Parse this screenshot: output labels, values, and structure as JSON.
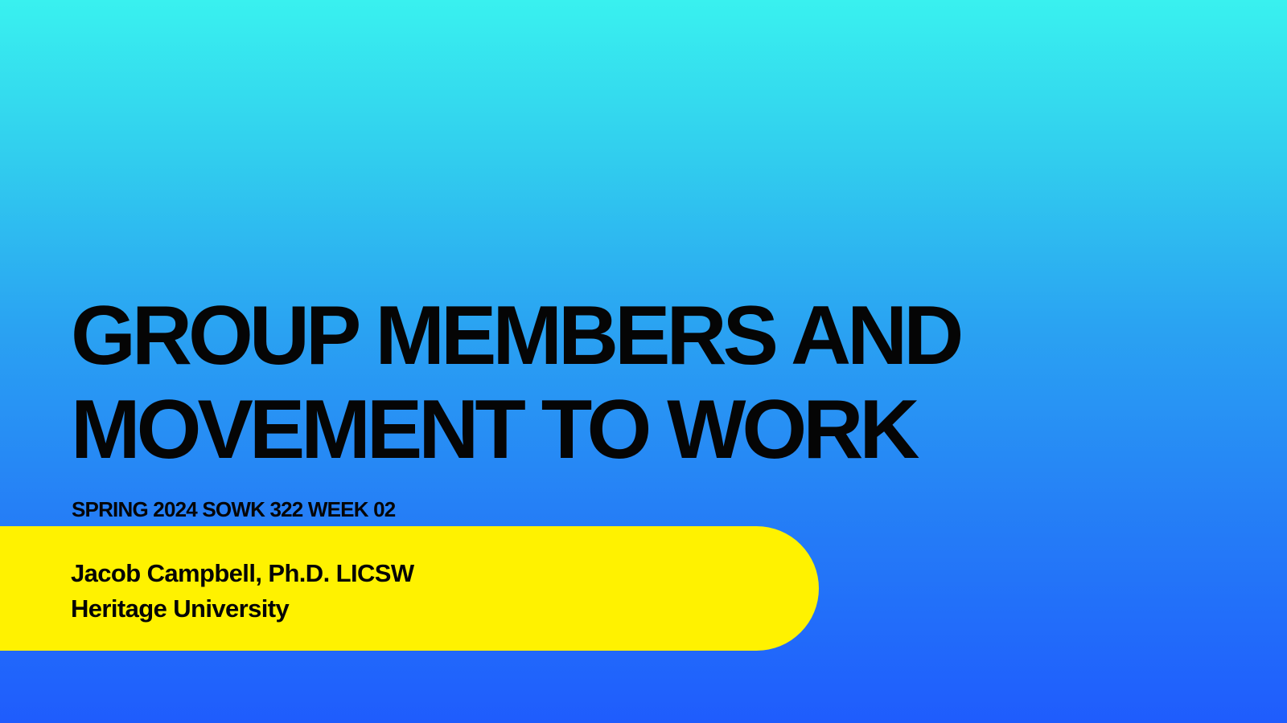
{
  "slide": {
    "title": "GROUP MEMBERS AND\nMOVEMENT TO WORK",
    "subtitle": "SPRING 2024 SOWK 322 WEEK 02",
    "presenter": {
      "name": "Jacob Campbell, Ph.D. LICSW",
      "institution": "Heritage University"
    }
  },
  "colors": {
    "banner": "#fff200",
    "text": "#050505"
  }
}
